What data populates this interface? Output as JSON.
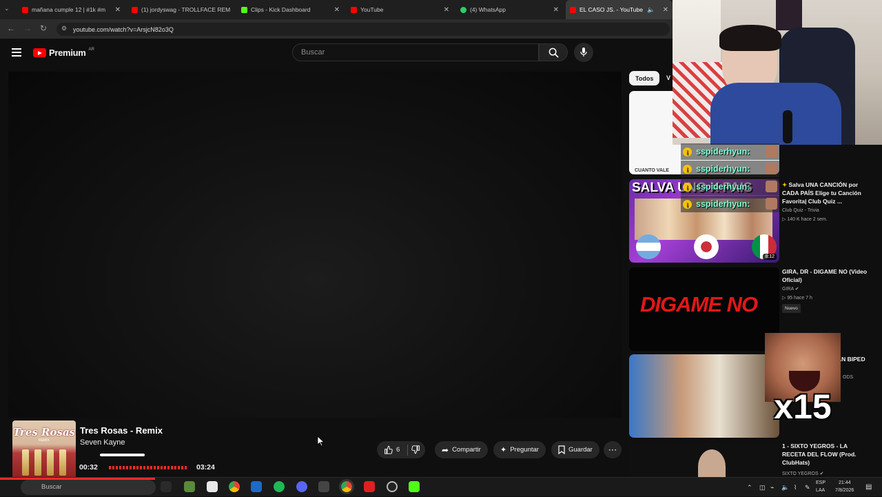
{
  "browser": {
    "tabs": [
      {
        "label": "mañana cumple 12 | #1k #m",
        "favicon": "#ff0000"
      },
      {
        "label": "(1) jordyswag - TROLLFACE REM",
        "favicon": "#ff0000"
      },
      {
        "label": "Clips - Kick Dashboard",
        "favicon": "#53fc18"
      },
      {
        "label": "YouTube",
        "favicon": "#ff0000"
      },
      {
        "label": "(4) WhatsApp",
        "favicon": "#25d366"
      },
      {
        "label": "EL CASO JS. - YouTube",
        "favicon": "#ff0000"
      }
    ],
    "url": "youtube.com/watch?v=ArsjcN82o3Q"
  },
  "youtube": {
    "logo_text": "Premium",
    "country_code": "AR",
    "search_placeholder": "Buscar",
    "chips": {
      "all": "Todos",
      "next": "V"
    },
    "actions": {
      "likes": "6",
      "share": "Compartir",
      "ask": "Preguntar",
      "save": "Guardar"
    },
    "sidebar_videos": [
      {
        "thumb_text": "CUANTO VALE",
        "title": "",
        "meta": []
      },
      {
        "thumb_text": "SALVA UNO X PAIS",
        "duration": "8:12",
        "title": "Salva UNA CANCIÓN por CADA PAÍS Elige tu Canción Favorita| Club Quiz ...",
        "channel": "Club Quiz - Trivia",
        "stats": "140 K  hace 2 sem."
      },
      {
        "thumb_text": "DIGAME NO",
        "title": "GIRA, DR - DIGAME NO (Video Oficial)",
        "channel": "GIRA",
        "stats": "95  hace 7 h",
        "badge": "Nuevo"
      },
      {
        "thumb_text": "",
        "title": "AN BIPED",
        "channel": "ODS"
      },
      {
        "thumb_text": "",
        "title": "1 - SIXTO YEGROS - LA RECETA DEL FLOW (Prod. ClubHats)",
        "channel": "SIXTO YEGROS"
      }
    ]
  },
  "overlay": {
    "chat_user": "sspiderhyun:",
    "meme_text": "x15",
    "now_playing": {
      "title": "Tres Rosas - Remix",
      "artist": "Seven Kayne",
      "current": "00:32",
      "total": "03:24",
      "progress_fraction": 0.82,
      "album_title": "Tres Rosas",
      "album_sub": "REMIX"
    }
  },
  "taskbar": {
    "search": "Buscar",
    "lang": "ESP",
    "layout": "LAA",
    "time": "21:44",
    "date": "7/8/2026"
  }
}
